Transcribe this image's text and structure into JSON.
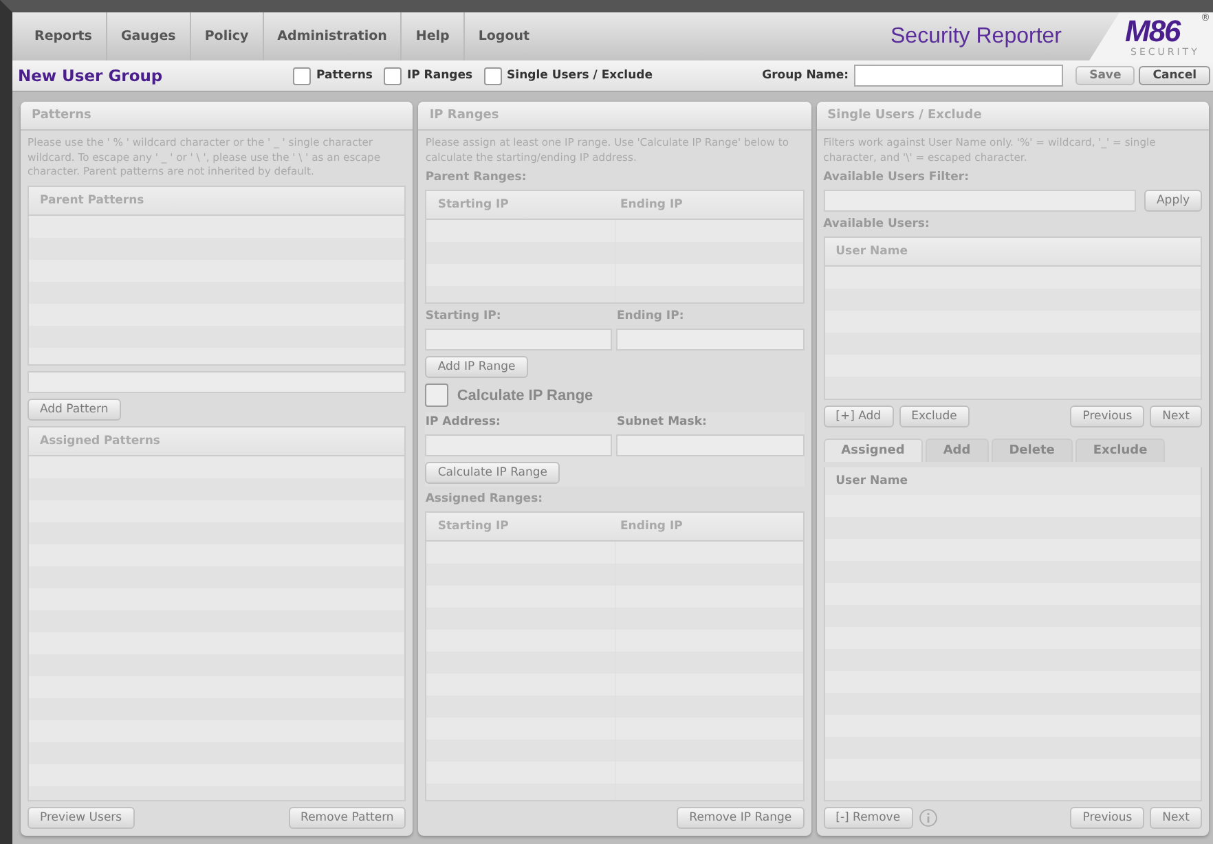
{
  "nav": {
    "items": [
      {
        "label": "Reports"
      },
      {
        "label": "Gauges"
      },
      {
        "label": "Policy"
      },
      {
        "label": "Administration"
      },
      {
        "label": "Help"
      },
      {
        "label": "Logout"
      }
    ],
    "product": "Security Reporter",
    "logo": {
      "mark": "M86",
      "sub": "SECURITY",
      "reg": "®"
    }
  },
  "toolbar": {
    "title": "New User Group",
    "sections": [
      {
        "label": "Patterns",
        "checked": false
      },
      {
        "label": "IP Ranges",
        "checked": false
      },
      {
        "label": "Single Users / Exclude",
        "checked": false
      }
    ],
    "group_name_label": "Group Name:",
    "buttons": [
      {
        "label": "Save",
        "disabled": true
      },
      {
        "label": "Cancel",
        "disabled": false
      }
    ]
  },
  "patterns": {
    "title": "Patterns",
    "note": "Please use the ' % ' wildcard character or the ' _ ' single character wildcard.  To escape any ' _ ' or ' \\ ', please use the ' \\ ' as an escape character.  Parent patterns are not inherited by default.",
    "parent_header": "Parent Patterns",
    "add_button": {
      "label": "Add Pattern",
      "disabled": true
    },
    "assigned_header": "Assigned Patterns",
    "buttons": [
      {
        "label": "Preview Users",
        "disabled": true
      },
      {
        "label": "Remove Pattern",
        "disabled": true
      }
    ]
  },
  "ip_ranges": {
    "title": "IP Ranges",
    "note": "Please assign at least one IP range.  Use 'Calculate IP Range' below to calculate the starting/ending IP address.",
    "parent_label": "Parent Ranges:",
    "columns": [
      "Starting IP",
      "Ending IP"
    ],
    "start_label": "Starting IP:",
    "end_label": "Ending IP:",
    "add_button": {
      "label": "Add IP Range",
      "disabled": true
    },
    "calculate": {
      "label": "Calculate IP Range",
      "checked": false
    },
    "ip_label": "IP Address:",
    "mask_label": "Subnet Mask:",
    "calc_button": {
      "label": "Calculate IP Range",
      "disabled": true
    },
    "assigned_label": "Assigned Ranges:",
    "assigned_columns": [
      "Starting IP",
      "Ending IP"
    ],
    "remove_button": {
      "label": "Remove IP Range",
      "disabled": true
    }
  },
  "single_users": {
    "title": "Single Users / Exclude",
    "note": "Filters work against User Name only.  '%' = wildcard, '_' = single character, and '\\' = escaped character.",
    "filter_label": "Available Users Filter:",
    "apply_button": {
      "label": "Apply",
      "disabled": true
    },
    "available_label": "Available Users:",
    "column": "User Name",
    "list_buttons": [
      {
        "label": "[+] Add",
        "disabled": true
      },
      {
        "label": "Exclude",
        "disabled": true
      },
      {
        "label": "Previous",
        "disabled": true
      },
      {
        "label": "Next",
        "disabled": true
      }
    ],
    "tabs": [
      {
        "label": "Assigned",
        "selected": true
      },
      {
        "label": "Add",
        "selected": false
      },
      {
        "label": "Delete",
        "selected": false
      },
      {
        "label": "Exclude",
        "selected": false
      }
    ],
    "assigned_column": "User Name",
    "bottom_buttons": [
      {
        "label": "[-] Remove",
        "disabled": true
      },
      {
        "label": "Previous",
        "disabled": true
      },
      {
        "label": "Next",
        "disabled": true
      }
    ]
  }
}
